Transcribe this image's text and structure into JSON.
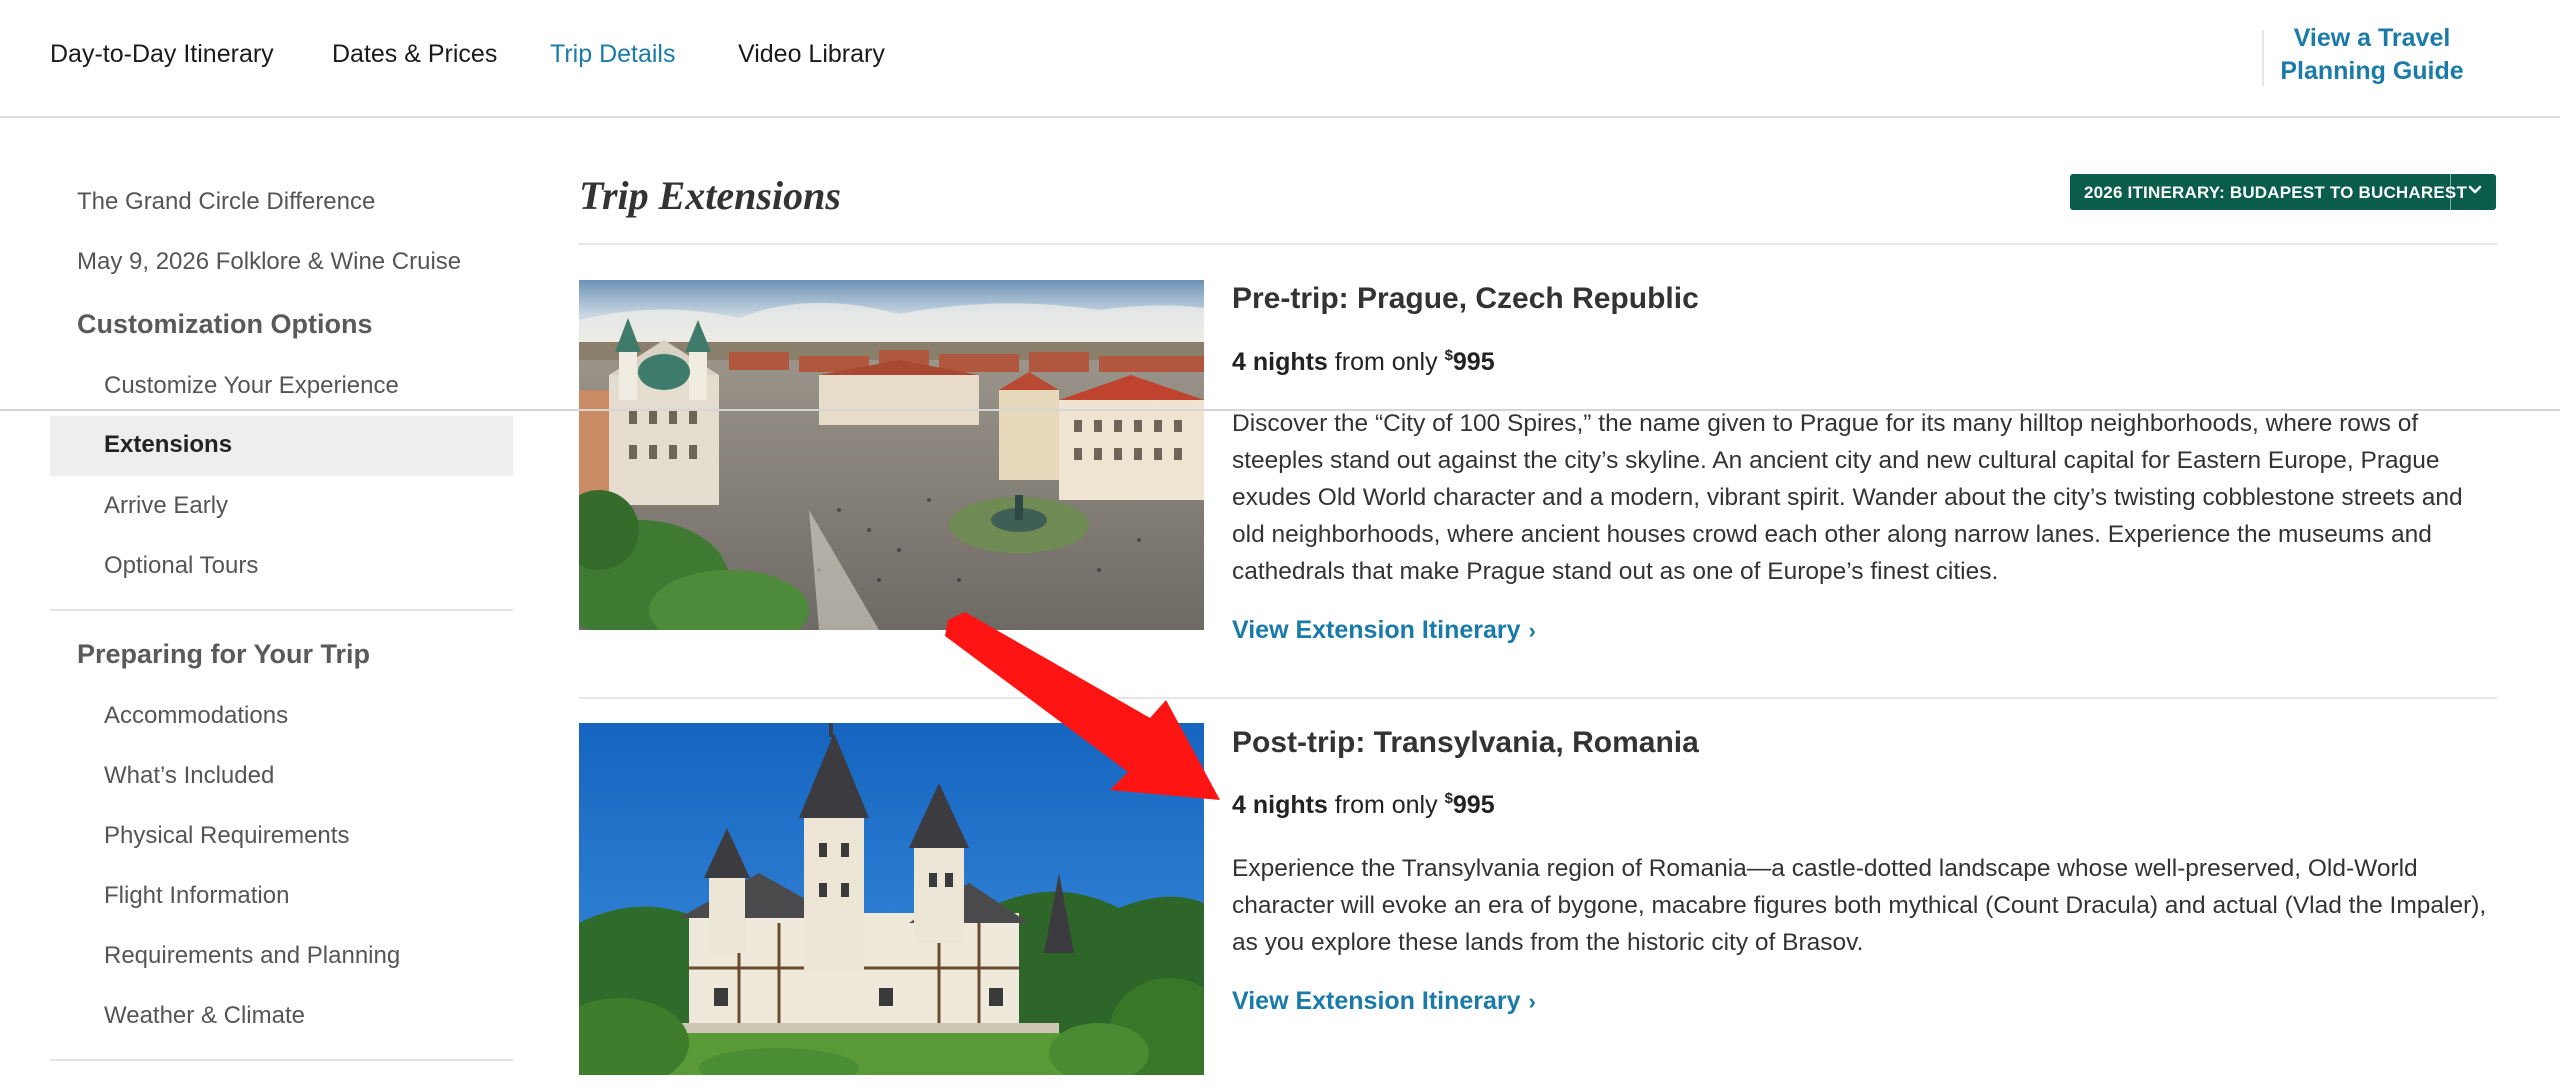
{
  "nav": {
    "tabs": [
      {
        "label": "Day-to-Day Itinerary"
      },
      {
        "label": "Dates & Prices"
      },
      {
        "label": "Trip Details"
      },
      {
        "label": "Video Library"
      }
    ],
    "active_tab": "Trip Details",
    "guide_line1": "View a Travel",
    "guide_line2": "Planning Guide"
  },
  "sidebar": {
    "link1": "The Grand Circle Difference",
    "link2": "May 9, 2026 Folklore & Wine Cruise",
    "section1": {
      "title": "Customization Options",
      "items": [
        "Customize Your Experience",
        "Extensions",
        "Arrive Early",
        "Optional Tours"
      ],
      "active": "Extensions"
    },
    "section2": {
      "title": "Preparing for Your Trip",
      "items": [
        "Accommodations",
        "What’s Included",
        "Physical Requirements",
        "Flight Information",
        "Requirements and Planning",
        "Weather & Climate"
      ]
    }
  },
  "main": {
    "title": "Trip Extensions",
    "itinerary_select": "2026 ITINERARY: BUDAPEST TO BUCHAREST",
    "extensions": [
      {
        "title": "Pre-trip: Prague, Czech Republic",
        "nights": "4 nights",
        "from_text": "from only",
        "currency": "$",
        "price": "995",
        "description": "Discover the “City of 100 Spires,” the name given to Prague for its many hilltop neighborhoods, where rows of steeples stand out against the city’s skyline. An ancient city and new cultural capital for Eastern Europe, Prague exudes Old World character and a modern, vibrant spirit. Wander about the city’s twisting cobblestone streets and old neighborhoods, where ancient houses crowd each other along narrow lanes. Experience the museums and cathedrals that make Prague stand out as one of Europe’s finest cities.",
        "link": "View Extension Itinerary",
        "link_icon": "chevron-right-icon"
      },
      {
        "title": "Post-trip: Transylvania, Romania",
        "nights": "4 nights",
        "from_text": "from only",
        "currency": "$",
        "price": "995",
        "description": "Experience the Transylvania region of Romania—a castle-dotted landscape whose well-preserved, Old-World character will evoke an era of bygone, macabre figures both mythical (Count Dracula) and actual (Vlad the Impaler), as you explore these lands from the historic city of Brasov.",
        "link": "View Extension Itinerary",
        "link_icon": "chevron-right-icon"
      }
    ]
  },
  "colors": {
    "link": "#1a7aa8",
    "selector_bg": "#0a5d4a",
    "annotation_arrow": "#ff1414",
    "active_bg": "#eeeeee"
  }
}
